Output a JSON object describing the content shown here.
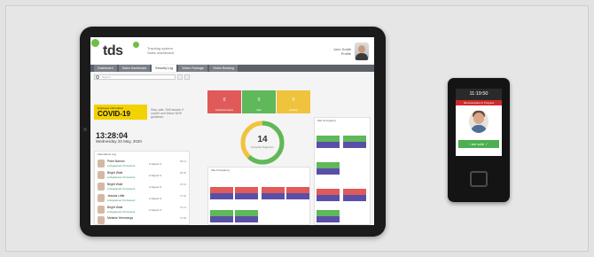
{
  "tablet": {
    "app": {
      "logo": "tds",
      "subtitle_line1": "Tracking system",
      "subtitle_line2": "Sales dashboard",
      "user_line1": "John Smith",
      "user_line2": "Profile"
    },
    "tabs": [
      {
        "label": "Dashboard",
        "active": false
      },
      {
        "label": "Sales Dashboard",
        "active": false
      },
      {
        "label": "Security Log",
        "active": true
      },
      {
        "label": "Visitor Package",
        "active": false
      },
      {
        "label": "Visitor Booking",
        "active": false
      }
    ],
    "search": {
      "placeholder": "Search"
    },
    "banner": {
      "line1": "Employee Information",
      "line2": "COVID-19",
      "note": "Stay safe. Self-isolate if unwell and follow NHS guidance."
    },
    "clock": {
      "time": "13:28:04",
      "date": "Wednesday 20 May, 2020"
    },
    "attendance": {
      "title": "Attendance Log",
      "rows": [
        {
          "name": "Peter Barnes",
          "sub": "● Registered, Permanent",
          "status": "● Signed In",
          "time": "08:13"
        },
        {
          "name": "Bright Wale",
          "sub": "● Registered, Permanent",
          "status": "● Signed In",
          "time": "08:06"
        },
        {
          "name": "Bright Wale",
          "sub": "● Registered, Permanent",
          "status": "● Signed In",
          "time": "07:42"
        },
        {
          "name": "Jessica Little",
          "sub": "● Registered, Permanent",
          "status": "● Signed In",
          "time": "07:36"
        },
        {
          "name": "Bright Wale",
          "sub": "● Registered, Permanent",
          "status": "● Signed In",
          "time": "07:21"
        },
        {
          "name": "Melanie Hemmings",
          "sub": "● Registered, Permanent",
          "status": "● Signed In",
          "time": "07:05"
        }
      ]
    },
    "stats": [
      {
        "label": "Confirmed Cases",
        "count": "0",
        "color": "#e05a5a"
      },
      {
        "label": "Safe",
        "count": "0",
        "color": "#5fb85a"
      },
      {
        "label": "Isolating",
        "count": "0",
        "color": "#f0c33c"
      }
    ],
    "donut": {
      "value": "14",
      "label": "Currently Signed In",
      "fraction": 0.62
    },
    "alerts_mid": {
      "title": "Site Occupancy"
    },
    "alerts_right": {
      "title": "Site Occupancy"
    }
  },
  "reader": {
    "time": "11:19:50",
    "alert": "Site Evacuation in Progress",
    "status": "I am safe ✓"
  }
}
